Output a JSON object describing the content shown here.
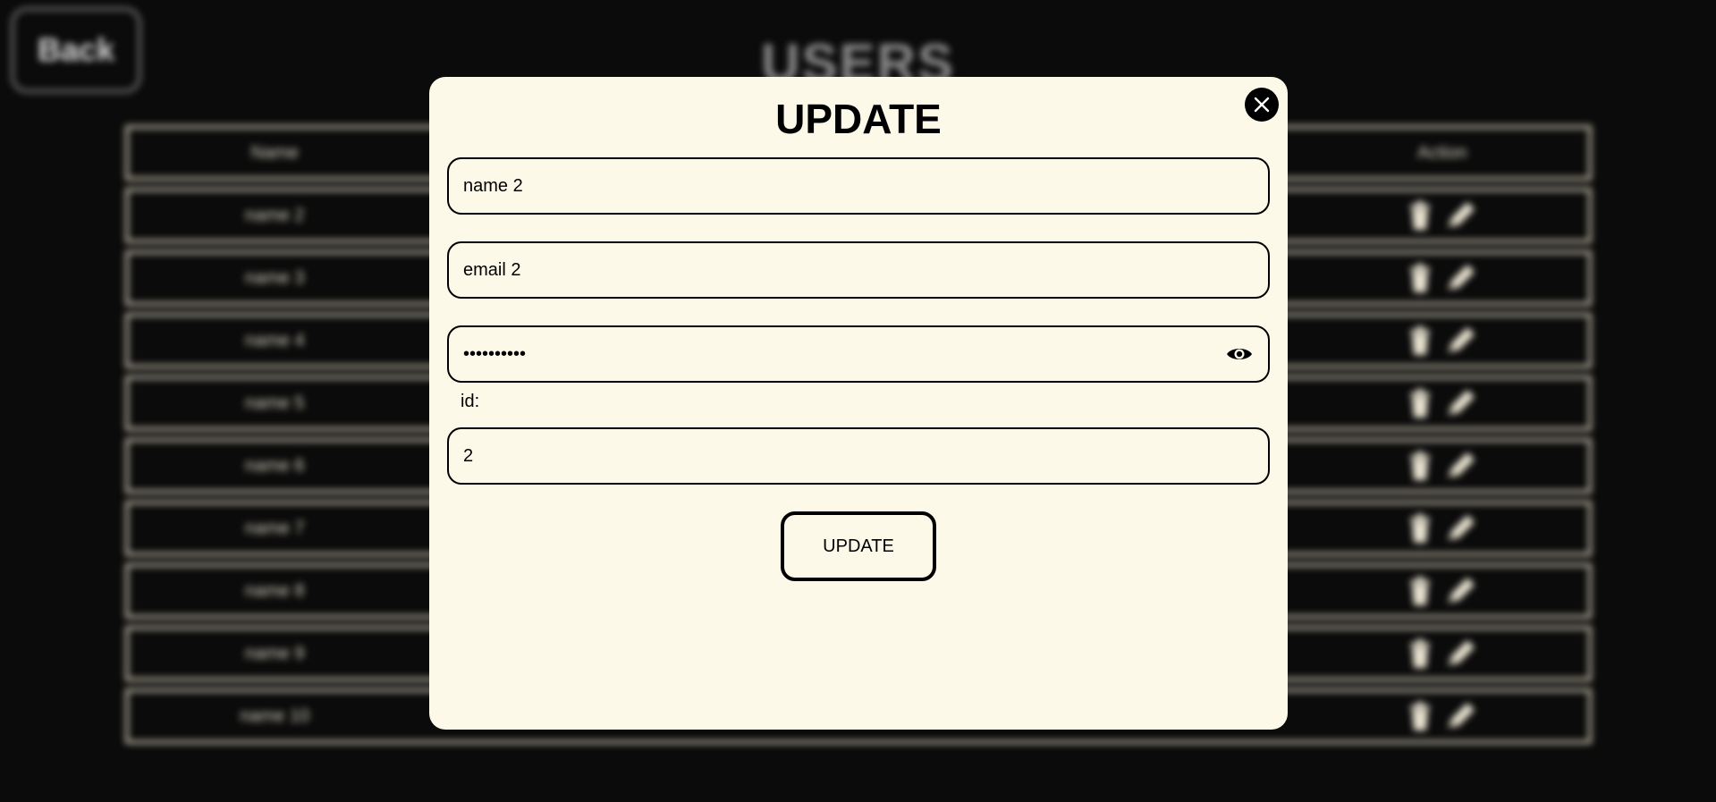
{
  "page": {
    "back_label": "Back",
    "title": "USERS"
  },
  "table": {
    "headers": [
      "Name",
      "",
      "",
      "",
      "Action"
    ],
    "rows": [
      {
        "name": "name 2"
      },
      {
        "name": "name 3"
      },
      {
        "name": "name 4"
      },
      {
        "name": "name 5"
      },
      {
        "name": "name 6"
      },
      {
        "name": "name 7"
      },
      {
        "name": "name 8"
      },
      {
        "name": "name 9"
      },
      {
        "name": "name 10"
      }
    ],
    "action_icons": [
      "trash-icon",
      "pencil-icon"
    ]
  },
  "modal": {
    "title": "UPDATE",
    "close_icon": "close-icon",
    "name_value": "name 2",
    "email_value": "email 2",
    "password_value": "••••••••••",
    "password_toggle_icon": "eye-icon",
    "id_label": "id:",
    "id_value": "2",
    "submit_label": "UPDATE"
  },
  "colors": {
    "backdrop": "#0b0b0b",
    "modal_bg": "#fdf9e8",
    "accent": "#000000"
  }
}
